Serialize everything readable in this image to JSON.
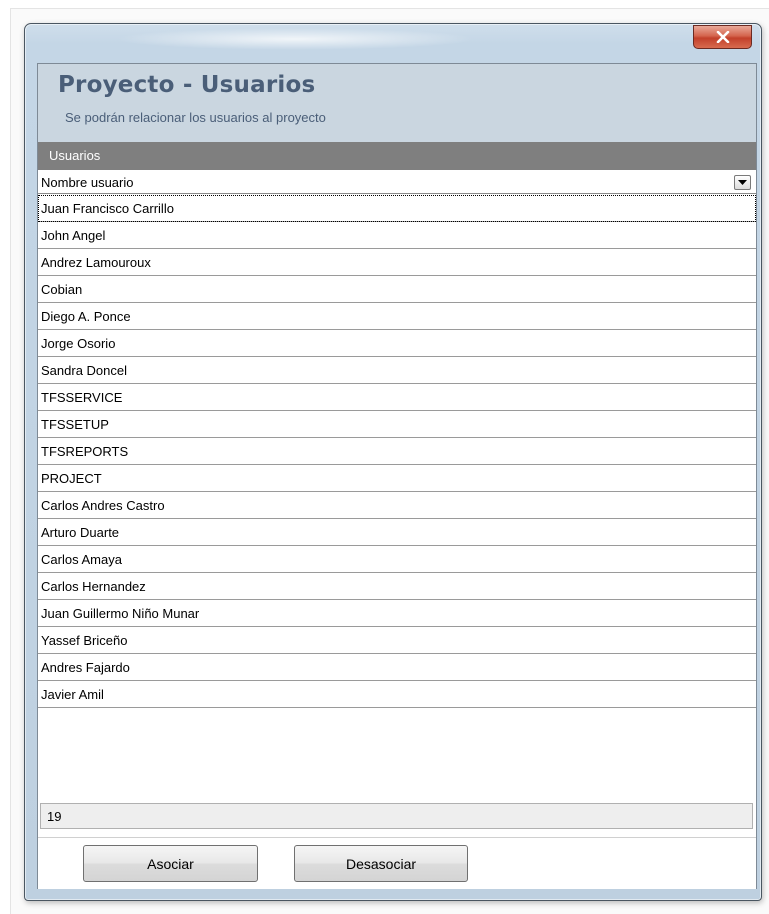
{
  "window": {
    "title": "",
    "close_icon": "close-icon",
    "accent": "#c2402b"
  },
  "header": {
    "title": "Proyecto - Usuarios",
    "subtitle": "Se podrán relacionar los usuarios al proyecto"
  },
  "grid": {
    "group_label": "Usuarios",
    "column_header": "Nombre usuario",
    "filter_icon": "dropdown-filter-icon",
    "rows": [
      "Juan Francisco Carrillo",
      "John Angel",
      "Andrez Lamouroux",
      "Cobian",
      "Diego A. Ponce",
      "Jorge Osorio",
      "Sandra Doncel",
      "TFSSERVICE",
      "TFSSETUP",
      "TFSREPORTS",
      "PROJECT",
      "Carlos Andres Castro",
      "Arturo Duarte",
      "Carlos Amaya",
      "Carlos Hernandez",
      "Juan Guillermo Niño Munar",
      "Yassef Briceño",
      "Andres Fajardo",
      "Javier Amil"
    ],
    "footer_count": "19"
  },
  "buttons": {
    "associate": "Asociar",
    "disassociate": "Desasociar"
  }
}
